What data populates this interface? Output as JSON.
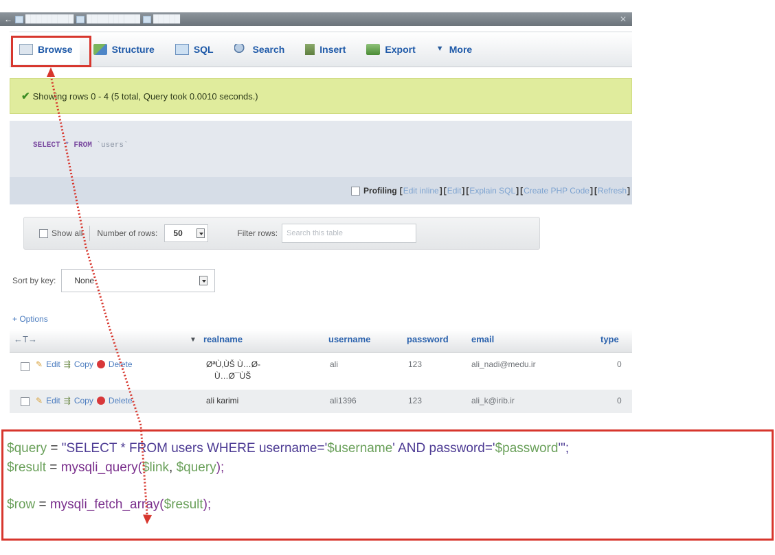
{
  "tabs": [
    {
      "label": "Browse",
      "icon": "browse-icon"
    },
    {
      "label": "Structure",
      "icon": "structure-icon"
    },
    {
      "label": "SQL",
      "icon": "sql-icon"
    },
    {
      "label": "Search",
      "icon": "search-icon"
    },
    {
      "label": "Insert",
      "icon": "insert-icon"
    },
    {
      "label": "Export",
      "icon": "export-icon"
    },
    {
      "label": "More",
      "icon": "chevron-down-icon"
    }
  ],
  "message": "Showing rows 0 - 4 (5 total, Query took 0.0010 seconds.)",
  "sql": {
    "select": "SELECT",
    "star": " * ",
    "from": "FROM",
    "table": " `users`"
  },
  "profiling": {
    "label": "Profiling",
    "links": [
      "Edit inline",
      "Edit",
      "Explain SQL",
      "Create PHP Code",
      "Refresh"
    ]
  },
  "nav": {
    "show_all": "Show all",
    "number_rows_label": "Number of rows:",
    "number_rows_value": "50",
    "filter_label": "Filter rows:",
    "filter_placeholder": "Search this table"
  },
  "sort": {
    "label": "Sort by key:",
    "value": "None"
  },
  "options": "+ Options",
  "table": {
    "arrows": "←T→",
    "columns": [
      "realname",
      "username",
      "password",
      "email",
      "type"
    ],
    "actions": [
      "Edit",
      "Copy",
      "Delete"
    ],
    "rows": [
      {
        "realname_1": "ØªÙ‚ÙŠ Ù…Ø-",
        "realname_2": "Ù…Ø¯ÙŠ",
        "username": "ali",
        "password": "123",
        "email": "ali_nadi@medu.ir",
        "type": "0"
      },
      {
        "realname": "ali karimi",
        "username": "ali1396",
        "password": "123",
        "email": "ali_k@irib.ir",
        "type": "0"
      }
    ]
  },
  "code": {
    "line1": {
      "var": "$query",
      "eq": " = ",
      "q1": "\"SELECT * FROM users WHERE username='",
      "uv": "$username",
      "q2": "' AND password='",
      "pv": "$password",
      "q3": "'\";"
    },
    "line2": {
      "var": "$result",
      "eq": " = ",
      "fn": "mysqli_query(",
      "a1": "$link",
      "c": ", ",
      "a2": "$query",
      "end": ");"
    },
    "line3": {
      "var": "$row",
      "eq": " = ",
      "fn": "mysqli_fetch_array(",
      "a1": "$result",
      "end": ");"
    }
  },
  "colors": {
    "highlight": "#d7362d",
    "success_bg": "#e0ec9d",
    "link": "#1e59a8"
  }
}
